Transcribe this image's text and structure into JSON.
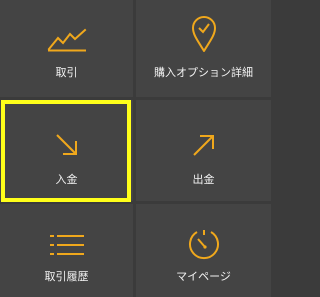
{
  "menu": {
    "items": [
      {
        "label": "取引",
        "icon": "chart-trend-icon"
      },
      {
        "label": "購入オプション詳細",
        "icon": "map-pin-check-icon"
      },
      {
        "label": "入金",
        "icon": "arrow-down-right-icon"
      },
      {
        "label": "出金",
        "icon": "arrow-up-right-icon"
      },
      {
        "label": "取引履歴",
        "icon": "list-icon"
      },
      {
        "label": "マイページ",
        "icon": "gauge-icon"
      }
    ],
    "selected": "入金"
  },
  "colors": {
    "background": "#3b3b3b",
    "tile": "#444444",
    "icon_accent": "#f0a81c",
    "label_text": "#f2f2f2",
    "highlight_border": "#ffff1a"
  }
}
